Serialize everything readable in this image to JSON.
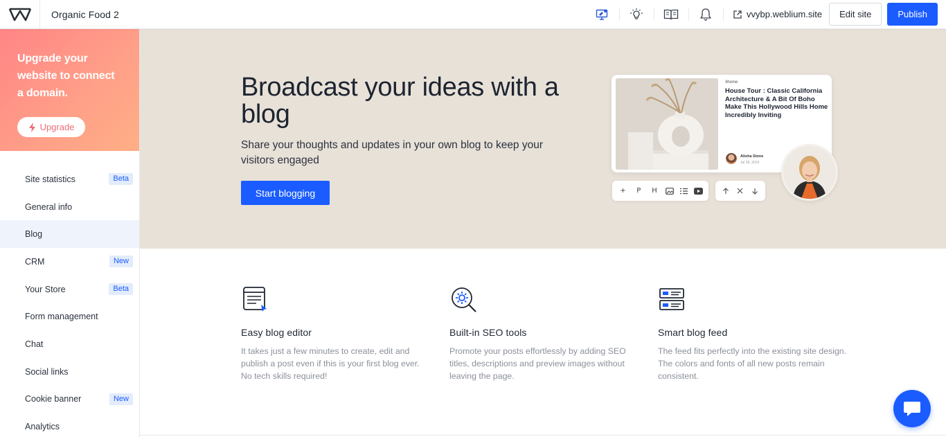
{
  "header": {
    "site_name": "Organic Food 2",
    "site_url": "vvybp.weblium.site",
    "edit_label": "Edit site",
    "publish_label": "Publish"
  },
  "sidebar": {
    "upgrade_text": "Upgrade your website to connect a domain.",
    "upgrade_button": "Upgrade",
    "items": [
      {
        "label": "Site statistics",
        "badge": "Beta"
      },
      {
        "label": "General info",
        "badge": ""
      },
      {
        "label": "Blog",
        "badge": ""
      },
      {
        "label": "CRM",
        "badge": "New"
      },
      {
        "label": "Your Store",
        "badge": "Beta"
      },
      {
        "label": "Form management",
        "badge": ""
      },
      {
        "label": "Chat",
        "badge": ""
      },
      {
        "label": "Social links",
        "badge": ""
      },
      {
        "label": "Cookie banner",
        "badge": "New"
      },
      {
        "label": "Analytics",
        "badge": ""
      }
    ]
  },
  "hero": {
    "title": "Broadcast your ideas with a blog",
    "subtitle": "Share your thoughts and updates in your own blog to keep your visitors engaged",
    "cta": "Start blogging",
    "preview": {
      "tag": "4home",
      "post_title": "House Tour : Classic California Architecture & A Bit Of Boho Make This Hollywood Hills Home Incredibly Inviting",
      "author": "Alisha Stone",
      "date": "Jul 28, 2019",
      "toolbar_left": [
        "+",
        "P",
        "H"
      ],
      "toolbar_right_icons": [
        "arrow-up-icon",
        "close-icon",
        "arrow-down-icon"
      ]
    }
  },
  "features": [
    {
      "title": "Easy blog editor",
      "desc": "It takes just a few minutes to create, edit and publish a post even if this is your first blog ever. No tech skills required!"
    },
    {
      "title": "Built-in SEO tools",
      "desc": "Promote your posts effortlessly by adding SEO titles, descriptions and preview images without leaving the page."
    },
    {
      "title": "Smart blog feed",
      "desc": "The feed fits perfectly into the existing site design. The colors and fonts of all new posts remain consistent."
    }
  ],
  "colors": {
    "accent": "#1a5cff",
    "hero_bg": "#e8e1d8",
    "upgrade_gradient_start": "#ff8585",
    "upgrade_gradient_end": "#ffaf86"
  }
}
